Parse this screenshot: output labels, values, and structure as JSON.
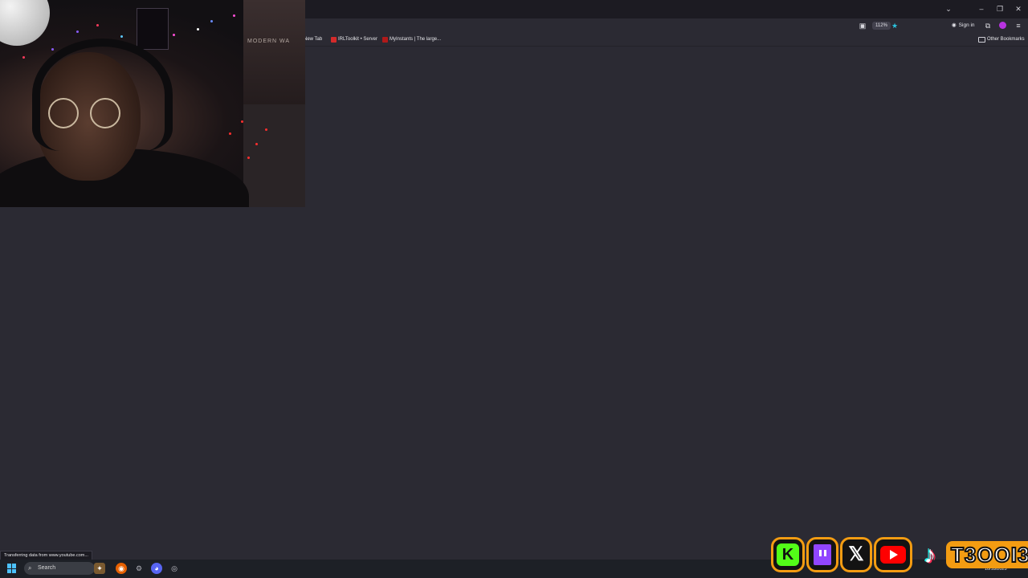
{
  "browser": {
    "zoom": "112%",
    "sign_in": "Sign in",
    "bookmarks": [
      {
        "label": "New Tab"
      },
      {
        "label": "IRLToolkit • Server"
      },
      {
        "label": "MyInstants | The large..."
      }
    ],
    "other_bookmarks": "Other Bookmarks"
  },
  "status_bar": {
    "text": "Transferring data from www.youtube.com..."
  },
  "taskbar": {
    "search_placeholder": "Search",
    "date": "10/18/2025"
  },
  "overlay": {
    "handle": "T3OOI3",
    "social_icons": [
      "kick-icon",
      "twitch-icon",
      "x-icon",
      "youtube-icon",
      "tiktok-icon"
    ],
    "accent_color": "#f39c12"
  },
  "webcam": {
    "poster_text": "MODERN WA"
  },
  "colors": {
    "page_bg": "#2b2a33",
    "titlebar_bg": "#1c1b22",
    "taskbar_bg": "#1d2026"
  }
}
